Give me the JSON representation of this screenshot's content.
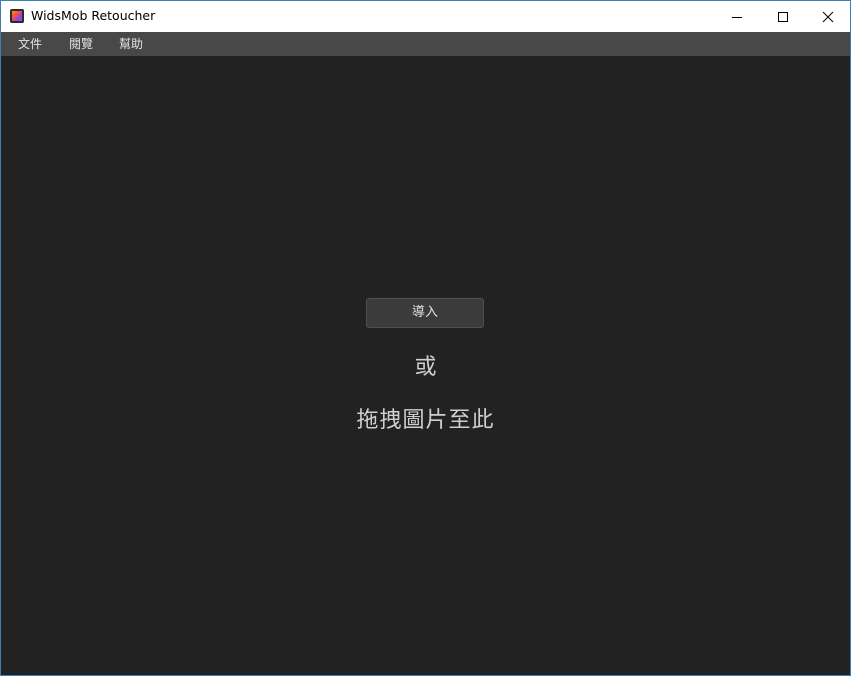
{
  "window": {
    "title": "WidsMob Retoucher",
    "app_icon": "widsmob-retoucher-app-icon",
    "controls": {
      "minimize_icon": "minimize-icon",
      "maximize_icon": "maximize-icon",
      "close_icon": "close-icon"
    }
  },
  "menubar": {
    "items": [
      {
        "label": "文件"
      },
      {
        "label": "閱覽"
      },
      {
        "label": "幫助"
      }
    ]
  },
  "main": {
    "import_label": "導入",
    "or_label": "或",
    "drag_label": "拖拽圖片至此"
  },
  "colors": {
    "workspace_bg": "#222222",
    "menubar_bg": "#484848",
    "button_bg": "#3b3b3b",
    "window_border": "#3c7fb1"
  }
}
